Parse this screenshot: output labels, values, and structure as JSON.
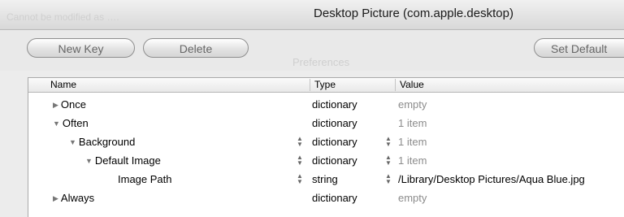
{
  "window": {
    "title": "Desktop Picture (com.apple.desktop)"
  },
  "background_ghost": {
    "line1": "Cannot be modified as ….",
    "line2": "Preferences"
  },
  "toolbar": {
    "new_key_label": "New Key",
    "delete_label": "Delete",
    "set_default_label": "Set Default"
  },
  "table": {
    "columns": [
      "Name",
      "Type",
      "Value"
    ],
    "rows": [
      {
        "name": "Once",
        "type": "dictionary",
        "value": "empty",
        "indent": 0,
        "disclosure": "collapsed",
        "editable": false
      },
      {
        "name": "Often",
        "type": "dictionary",
        "value": "1 item",
        "indent": 0,
        "disclosure": "expanded",
        "editable": false
      },
      {
        "name": "Background",
        "type": "dictionary",
        "value": "1 item",
        "indent": 1,
        "disclosure": "expanded",
        "editable": true
      },
      {
        "name": "Default Image",
        "type": "dictionary",
        "value": "1 item",
        "indent": 2,
        "disclosure": "expanded",
        "editable": true
      },
      {
        "name": "Image Path",
        "type": "string",
        "value": "/Library/Desktop Pictures/Aqua Blue.jpg",
        "indent": 3,
        "disclosure": "none",
        "editable": true
      },
      {
        "name": "Always",
        "type": "dictionary",
        "value": "empty",
        "indent": 0,
        "disclosure": "collapsed",
        "editable": false
      }
    ]
  }
}
